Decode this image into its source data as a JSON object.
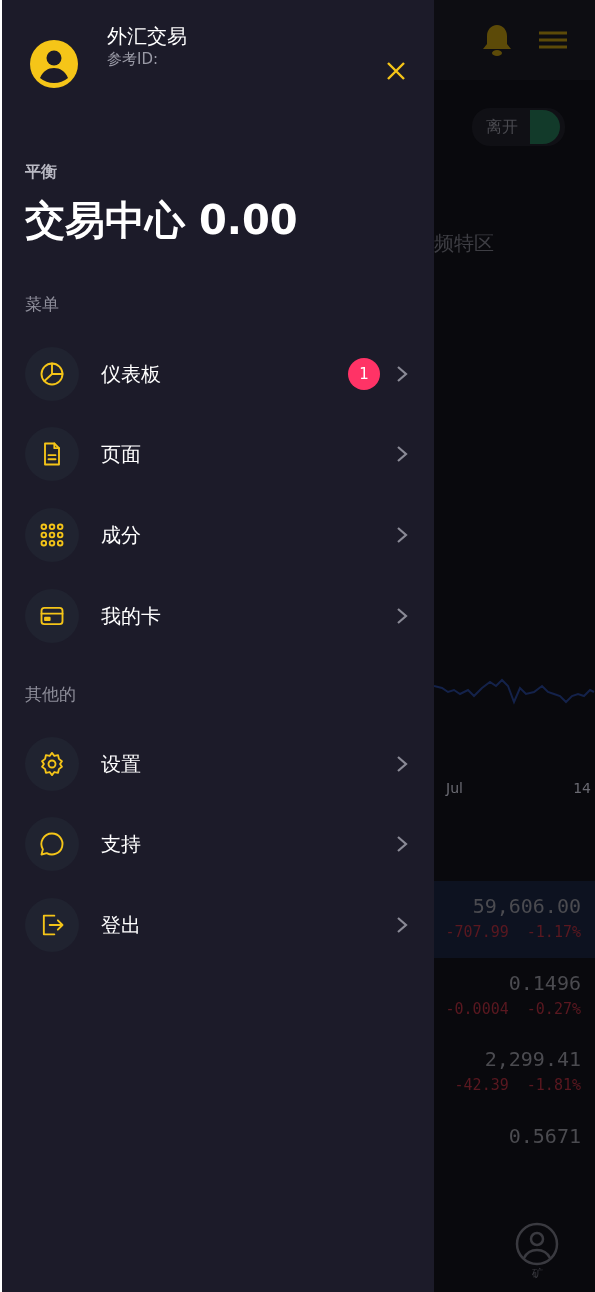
{
  "drawer": {
    "user": {
      "name": "外汇交易",
      "ref_label": "参考ID:"
    },
    "balance": {
      "label": "平衡",
      "value": "交易中心 0.00"
    },
    "sections": [
      {
        "title": "菜单",
        "items": [
          {
            "label": "仪表板",
            "kind": "pie",
            "badge": "1"
          },
          {
            "label": "页面",
            "kind": "document"
          },
          {
            "label": "成分",
            "kind": "grid"
          },
          {
            "label": "我的卡",
            "kind": "card"
          }
        ]
      },
      {
        "title": "其他的",
        "items": [
          {
            "label": "设置",
            "kind": "gear"
          },
          {
            "label": "支持",
            "kind": "chat"
          },
          {
            "label": "登出",
            "kind": "logout"
          }
        ]
      }
    ]
  },
  "background": {
    "toggle": {
      "label": "离开",
      "on": true
    },
    "heading": "频特区",
    "chart_axis": [
      "Jul",
      "14"
    ],
    "prices": [
      {
        "price": "59,606.00",
        "change": "-707.99",
        "percent": "-1.17%",
        "selected": true
      },
      {
        "price": "0.1496",
        "change": "-0.0004",
        "percent": "-0.27%",
        "selected": false
      },
      {
        "price": "2,299.41",
        "change": "-42.39",
        "percent": "-1.81%",
        "selected": false
      },
      {
        "price": "0.5671",
        "selected": false
      }
    ],
    "bottom_nav": [
      {
        "label": "矿"
      }
    ]
  }
}
